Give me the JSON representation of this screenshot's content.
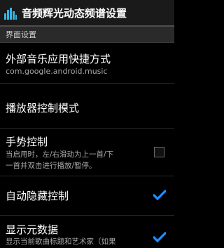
{
  "app": {
    "title": "音频辉光动态频谱设置",
    "icon": "equalizer-icon"
  },
  "section_header": "界面设置",
  "items": [
    {
      "title": "外部音乐应用快捷方式",
      "summary": "com.google.android.music"
    },
    {
      "title": "播放器控制模式"
    },
    {
      "title": "手势控制",
      "summary_line1": "当启用时，左/右滑动为上一首/下",
      "summary_line2": "一首并双击进行播放/暂停。",
      "checked": false
    },
    {
      "title": "自动隐藏控制",
      "checked": true
    },
    {
      "title": "显示元数据",
      "summary": "显示当前歌曲标题和艺术家（如果",
      "checked": true
    }
  ],
  "colors": {
    "accent": "#33b5e5",
    "check": "#1e90ff"
  }
}
